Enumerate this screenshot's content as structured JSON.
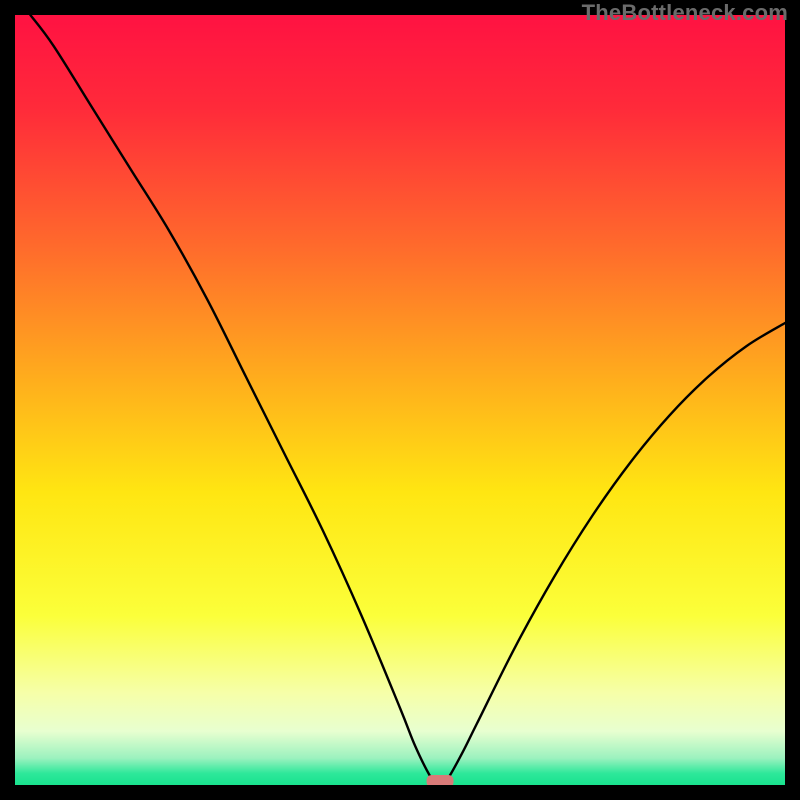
{
  "watermark": "TheBottleneck.com",
  "chart_data": {
    "type": "line",
    "title": "",
    "xlabel": "",
    "ylabel": "",
    "xlim": [
      0,
      100
    ],
    "ylim": [
      0,
      100
    ],
    "x": [
      2,
      5,
      10,
      15,
      20,
      25,
      30,
      35,
      40,
      45,
      50,
      52,
      54,
      55,
      56,
      58,
      60,
      65,
      70,
      75,
      80,
      85,
      90,
      95,
      100
    ],
    "y": [
      100,
      96,
      88,
      80,
      72,
      63,
      53,
      43,
      33,
      22,
      10,
      5,
      1,
      0,
      0.5,
      4,
      8,
      18,
      27,
      35,
      42,
      48,
      53,
      57,
      60
    ],
    "gradient_stops": [
      {
        "offset": 0.0,
        "color": "#ff1242"
      },
      {
        "offset": 0.12,
        "color": "#ff2a3a"
      },
      {
        "offset": 0.3,
        "color": "#ff6a2c"
      },
      {
        "offset": 0.48,
        "color": "#ffb01c"
      },
      {
        "offset": 0.62,
        "color": "#ffe612"
      },
      {
        "offset": 0.78,
        "color": "#fbff3a"
      },
      {
        "offset": 0.88,
        "color": "#f6ffa8"
      },
      {
        "offset": 0.93,
        "color": "#e8ffd0"
      },
      {
        "offset": 0.965,
        "color": "#9cf2bf"
      },
      {
        "offset": 0.985,
        "color": "#2de89a"
      },
      {
        "offset": 1.0,
        "color": "#19e28e"
      }
    ],
    "marker": {
      "x": 55.2,
      "y": 0.5,
      "w": 3.5,
      "h": 1.6,
      "color": "#d87a78"
    },
    "curve_color": "#000000",
    "curve_width": 2.4
  }
}
